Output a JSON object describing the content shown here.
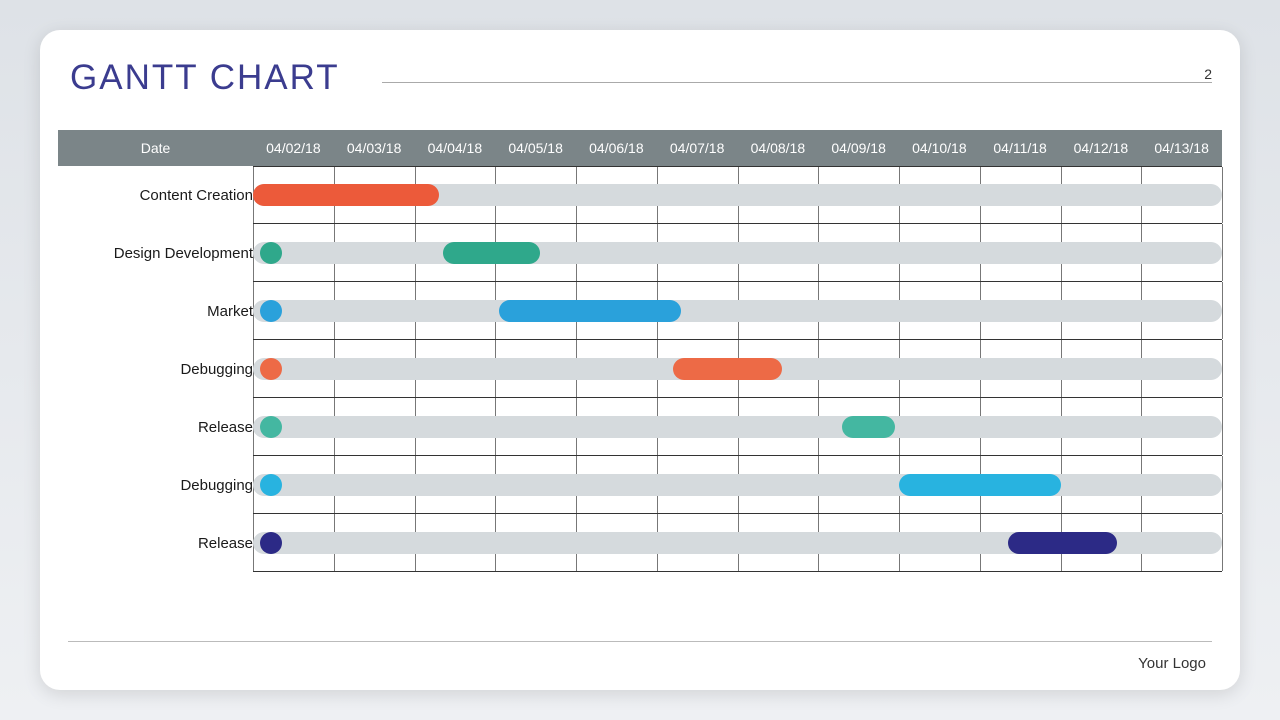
{
  "title": "GANTT CHART",
  "page_number": "2",
  "footer_logo": "Your Logo",
  "date_header_label": "Date",
  "chart_data": {
    "type": "bar",
    "title": "GANTT CHART",
    "xlabel": "Date",
    "ylabel": "",
    "categories": [
      "04/02/18",
      "04/03/18",
      "04/04/18",
      "04/05/18",
      "04/06/18",
      "04/07/18",
      "04/08/18",
      "04/09/18",
      "04/10/18",
      "04/11/18",
      "04/12/18",
      "04/13/18"
    ],
    "x_range_days": 12,
    "tasks": [
      {
        "label": "Content Creation",
        "start_day": 0.0,
        "duration_days": 2.3,
        "color": "#ec5a3a",
        "dot": false
      },
      {
        "label": "Design Development",
        "start_day": 2.35,
        "duration_days": 1.2,
        "color": "#2fa88b",
        "dot": true,
        "dot_color": "#2fa88b"
      },
      {
        "label": "Market",
        "start_day": 3.05,
        "duration_days": 2.25,
        "color": "#2aa1db",
        "dot": true,
        "dot_color": "#2aa1db"
      },
      {
        "label": "Debugging",
        "start_day": 5.2,
        "duration_days": 1.35,
        "color": "#ed6a46",
        "dot": true,
        "dot_color": "#ed6a46"
      },
      {
        "label": "Release",
        "start_day": 7.3,
        "duration_days": 0.65,
        "color": "#44b7a1",
        "dot": true,
        "dot_color": "#44b7a1"
      },
      {
        "label": "Debugging",
        "start_day": 8.0,
        "duration_days": 2.0,
        "color": "#28b3e0",
        "dot": true,
        "dot_color": "#28b3e0"
      },
      {
        "label": "Release",
        "start_day": 9.35,
        "duration_days": 1.35,
        "color": "#2c2a86",
        "dot": true,
        "dot_color": "#2c2a86"
      }
    ]
  }
}
